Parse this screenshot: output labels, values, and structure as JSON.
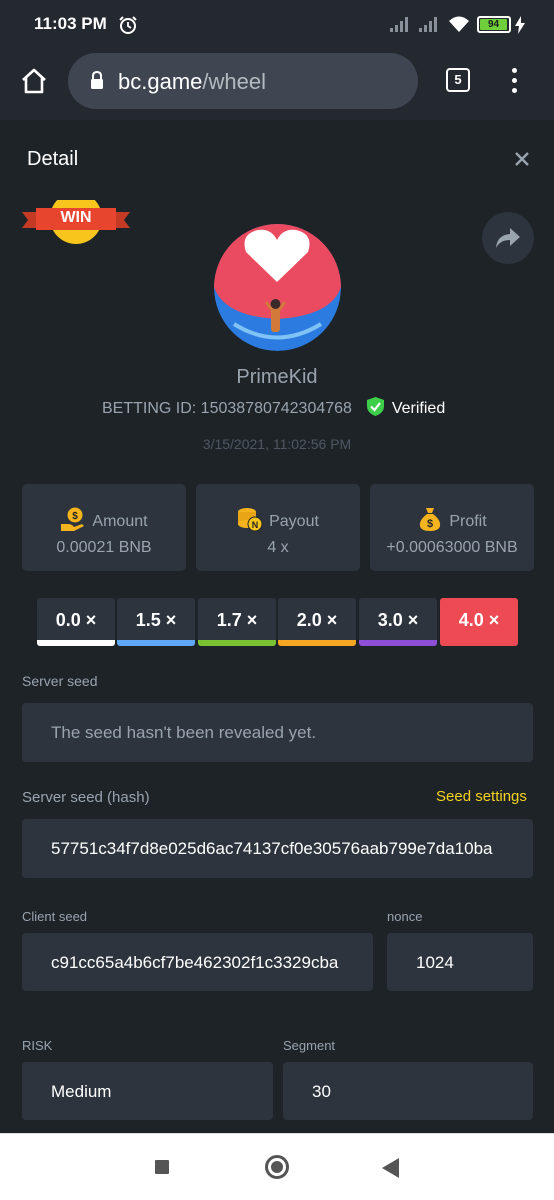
{
  "status_bar": {
    "time": "11:03 PM",
    "battery": "94",
    "icons": [
      "alarm-icon",
      "signal-icon",
      "signal-icon",
      "wifi-icon",
      "battery-icon",
      "charging-icon"
    ]
  },
  "browser": {
    "url_domain": "bc.game",
    "url_path": "/wheel",
    "tab_count": "5"
  },
  "detail": {
    "title": "Detail",
    "win_badge": "WIN",
    "username": "PrimeKid",
    "betting_id": "BETTING ID: 15038780742304768",
    "verified": "Verified",
    "timestamp": "3/15/2021, 11:02:56 PM"
  },
  "stats": [
    {
      "label": "Amount",
      "value": "0.00021 BNB",
      "icon": "money-hand-icon"
    },
    {
      "label": "Payout",
      "value": "4 x",
      "icon": "coins-icon"
    },
    {
      "label": "Profit",
      "value": "+0.00063000 BNB",
      "icon": "money-bag-icon"
    }
  ],
  "multipliers": [
    {
      "label": "0.0 ×",
      "color": "#ffffff",
      "selected": false
    },
    {
      "label": "1.5 ×",
      "color": "#5fa8f5",
      "selected": false
    },
    {
      "label": "1.7 ×",
      "color": "#7ac232",
      "selected": false
    },
    {
      "label": "2.0 ×",
      "color": "#f5a623",
      "selected": false
    },
    {
      "label": "3.0 ×",
      "color": "#8e4fd8",
      "selected": false
    },
    {
      "label": "4.0 ×",
      "color": "#ed4a54",
      "selected": true
    }
  ],
  "fields": {
    "server_seed_label": "Server seed",
    "server_seed_value": "The seed hasn't been revealed yet.",
    "server_seed_hash_label": "Server seed (hash)",
    "seed_settings": "Seed settings",
    "server_seed_hash_value": "57751c34f7d8e025d6ac74137cf0e30576aab799e7da10ba",
    "client_seed_label": "Client seed",
    "client_seed_value": "c91cc65a4b6cf7be462302f1c3329cba",
    "nonce_label": "nonce",
    "nonce_value": "1024",
    "risk_label": "RISK",
    "risk_value": "Medium",
    "segment_label": "Segment",
    "segment_value": "30"
  },
  "colors": {
    "background": "#1e2328",
    "card": "#2d343d",
    "accent_yellow": "#f5d31d",
    "win_red": "#ed4a54",
    "muted_text": "#99a4af"
  }
}
